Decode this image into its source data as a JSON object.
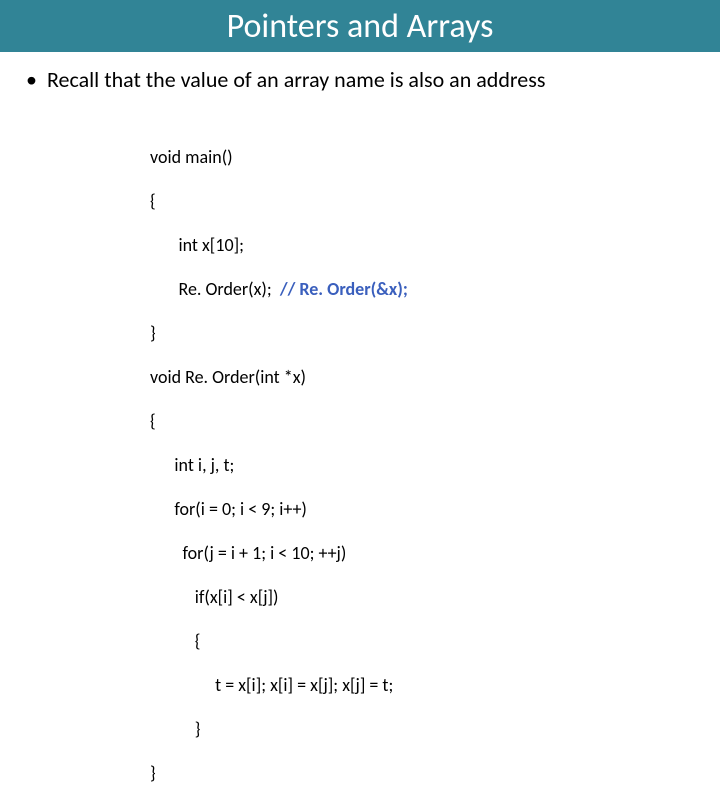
{
  "title": "Pointers and Arrays",
  "bullet": "Recall that the value of an array name is also an address",
  "code": {
    "l1": "void main()",
    "l2": "{",
    "l3": "       int x[10];",
    "l4a": "       Re. Order(x);  ",
    "l4_comment": "// Re. Order(&x);",
    "l5": "}",
    "l6": "void Re. Order(int *x)",
    "l7": "{",
    "l8": "      int i, j, t;",
    "l9": "      for(i = 0; i < 9; i++)",
    "l10": "        for(j = i + 1; i < 10; ++j)",
    "l11": "           if(x[i] < x[j])",
    "l12": "           {",
    "l13": "                t = x[i]; x[i] = x[j]; x[j] = t;",
    "l14": "           }",
    "l15": "}"
  }
}
